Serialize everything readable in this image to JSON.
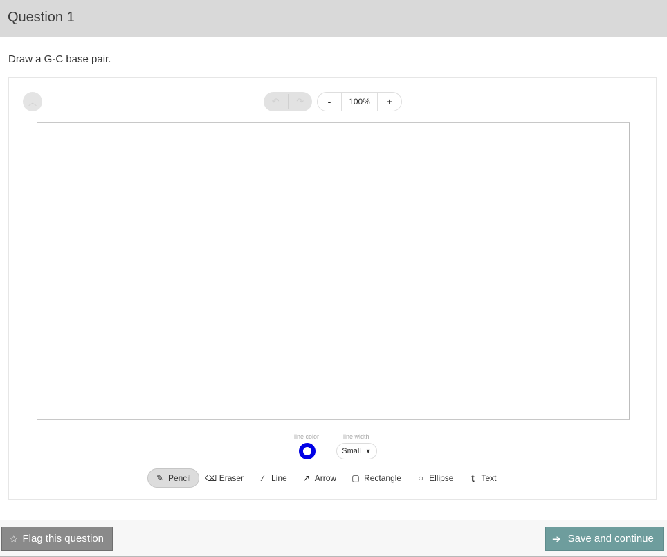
{
  "header": {
    "title": "Question 1"
  },
  "question": {
    "prompt": "Draw a G-C base pair."
  },
  "toolbar": {
    "zoom_out_label": "-",
    "zoom_value": "100%",
    "zoom_in_label": "+"
  },
  "style_controls": {
    "line_color_label": "line color",
    "line_color": "#0000e6",
    "line_width_label": "line width",
    "line_width_value": "Small"
  },
  "tools": [
    {
      "label": "Pencil",
      "icon": "pencil-icon",
      "active": true
    },
    {
      "label": "Eraser",
      "icon": "eraser-icon",
      "active": false
    },
    {
      "label": "Line",
      "icon": "line-icon",
      "active": false
    },
    {
      "label": "Arrow",
      "icon": "arrow-icon",
      "active": false
    },
    {
      "label": "Rectangle",
      "icon": "rectangle-icon",
      "active": false
    },
    {
      "label": "Ellipse",
      "icon": "ellipse-icon",
      "active": false
    },
    {
      "label": "Text",
      "icon": "text-icon",
      "active": false
    }
  ],
  "footer": {
    "flag_label": "Flag this question",
    "save_label": "Save and continue"
  }
}
